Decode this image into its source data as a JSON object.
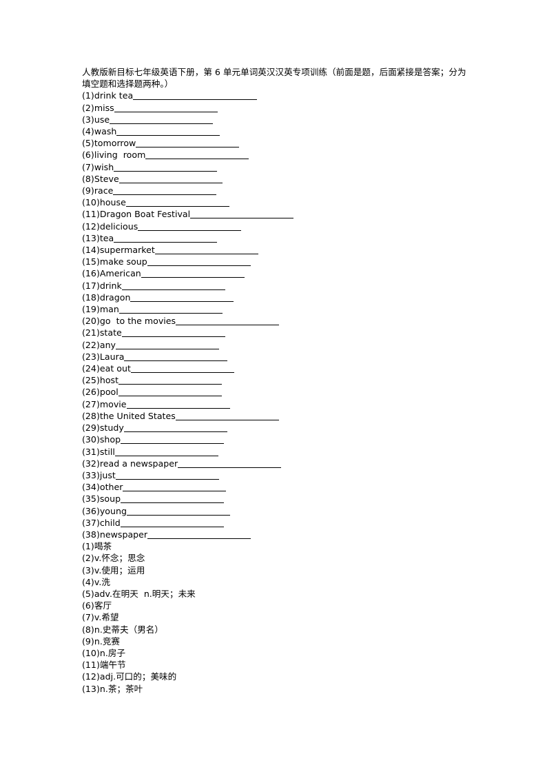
{
  "document": {
    "title": "人教版新目标七年级英语下册，第 6 单元单词英汉汉英专项训练（前面是题，后面紧接是答案；分为填空题和选择题两种。）"
  },
  "questions": [
    {
      "num": "(1)",
      "term": "drink tea",
      "blank_width": 180
    },
    {
      "num": "(2)",
      "term": "miss",
      "blank_width": 150
    },
    {
      "num": "(3)",
      "term": "use",
      "blank_width": 150
    },
    {
      "num": "(4)",
      "term": "wash",
      "blank_width": 150
    },
    {
      "num": "(5)",
      "term": "tomorrow",
      "blank_width": 150
    },
    {
      "num": "(6)",
      "term": "living  room",
      "blank_width": 150
    },
    {
      "num": "(7)",
      "term": "wish",
      "blank_width": 150
    },
    {
      "num": "(8)",
      "term": "Steve",
      "blank_width": 150
    },
    {
      "num": "(9)",
      "term": "race",
      "blank_width": 150
    },
    {
      "num": "(10)",
      "term": "house",
      "blank_width": 150
    },
    {
      "num": "(11)",
      "term": "Dragon Boat Festival",
      "blank_width": 150
    },
    {
      "num": "(12)",
      "term": "delicious",
      "blank_width": 150
    },
    {
      "num": "(13)",
      "term": "tea",
      "blank_width": 150
    },
    {
      "num": "(14)",
      "term": "supermarket",
      "blank_width": 150
    },
    {
      "num": "(15)",
      "term": "make soup",
      "blank_width": 150
    },
    {
      "num": "(16)",
      "term": "American",
      "blank_width": 150
    },
    {
      "num": "(17)",
      "term": "drink",
      "blank_width": 150
    },
    {
      "num": "(18)",
      "term": "dragon",
      "blank_width": 150
    },
    {
      "num": "(19)",
      "term": "man",
      "blank_width": 150
    },
    {
      "num": "(20)",
      "term": "go  to the movies",
      "blank_width": 150
    },
    {
      "num": "(21)",
      "term": "state",
      "blank_width": 150
    },
    {
      "num": "(22)",
      "term": "any",
      "blank_width": 150
    },
    {
      "num": "(23)",
      "term": "Laura",
      "blank_width": 150
    },
    {
      "num": "(24)",
      "term": "eat out",
      "blank_width": 150
    },
    {
      "num": "(25)",
      "term": "host",
      "blank_width": 150
    },
    {
      "num": "(26)",
      "term": "pool",
      "blank_width": 150
    },
    {
      "num": "(27)",
      "term": "movie",
      "blank_width": 150
    },
    {
      "num": "(28)",
      "term": "the United States",
      "blank_width": 150
    },
    {
      "num": "(29)",
      "term": "study",
      "blank_width": 150
    },
    {
      "num": "(30)",
      "term": "shop",
      "blank_width": 150
    },
    {
      "num": "(31)",
      "term": "still",
      "blank_width": 150
    },
    {
      "num": "(32)",
      "term": "read a newspaper",
      "blank_width": 150
    },
    {
      "num": "(33)",
      "term": "just",
      "blank_width": 150
    },
    {
      "num": "(34)",
      "term": "other",
      "blank_width": 150
    },
    {
      "num": "(35)",
      "term": "soup",
      "blank_width": 150
    },
    {
      "num": "(36)",
      "term": "young",
      "blank_width": 150
    },
    {
      "num": "(37)",
      "term": "child",
      "blank_width": 150
    },
    {
      "num": "(38)",
      "term": "newspaper",
      "blank_width": 150
    }
  ],
  "answers": [
    {
      "num": "(1)",
      "text": "喝茶"
    },
    {
      "num": "(2)",
      "text": "v.怀念；思念"
    },
    {
      "num": "(3)",
      "text": "v.使用；运用"
    },
    {
      "num": "(4)",
      "text": "v.洗"
    },
    {
      "num": "(5)",
      "text": "adv.在明天  n.明天；未来"
    },
    {
      "num": "(6)",
      "text": "客厅"
    },
    {
      "num": "(7)",
      "text": "v.希望"
    },
    {
      "num": "(8)",
      "text": "n.史蒂夫（男名）"
    },
    {
      "num": "(9)",
      "text": "n.竞赛"
    },
    {
      "num": "(10)",
      "text": "n.房子"
    },
    {
      "num": "(11)",
      "text": "端午节"
    },
    {
      "num": "(12)",
      "text": "adj.可口的；美味的"
    },
    {
      "num": "(13)",
      "text": "n.茶；茶叶"
    }
  ]
}
